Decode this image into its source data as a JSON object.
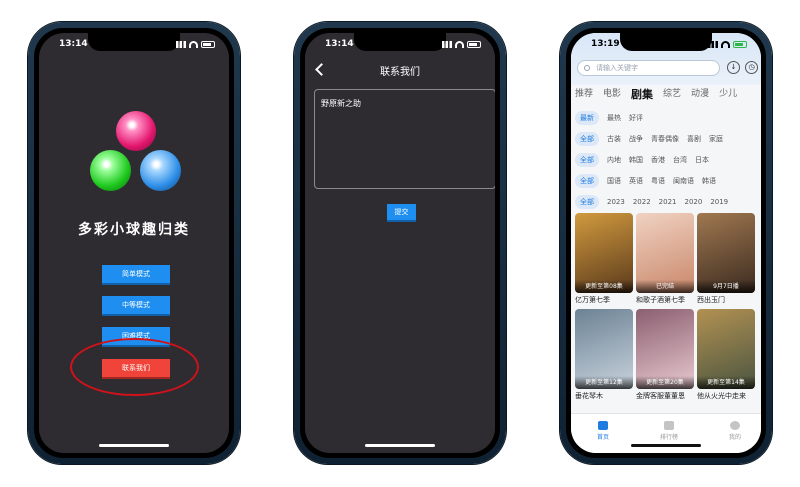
{
  "phone1": {
    "time": "13:14",
    "title": "多彩小球趣归类",
    "buttons": [
      "简单模式",
      "中等模式",
      "困难模式",
      "联系我们"
    ]
  },
  "phone2": {
    "time": "13:14",
    "nav_title": "联系我们",
    "textarea_value": "野原新之助",
    "submit": "提交"
  },
  "phone3": {
    "time": "13:19",
    "search_placeholder": "请输入关键字",
    "category_tabs": [
      "推荐",
      "电影",
      "剧集",
      "综艺",
      "动漫",
      "少儿"
    ],
    "active_category": "剧集",
    "filters": [
      [
        "最新",
        "最热",
        "好评"
      ],
      [
        "全部",
        "古装",
        "战争",
        "青春偶像",
        "喜剧",
        "家庭"
      ],
      [
        "全部",
        "内地",
        "韩国",
        "香港",
        "台湾",
        "日本"
      ],
      [
        "全部",
        "国语",
        "英语",
        "粤语",
        "闽南语",
        "韩语"
      ],
      [
        "全部",
        "2023",
        "2022",
        "2021",
        "2020",
        "2019"
      ]
    ],
    "cards": [
      {
        "name": "亿万第七季",
        "tag": "更新至第08集",
        "color1": "#5a3a1c",
        "color2": "#d19a3e"
      },
      {
        "name": "和歌子酒第七季",
        "tag": "已完结",
        "color1": "#c9876a",
        "color2": "#f0d2c2"
      },
      {
        "name": "西出玉门",
        "tag": "9月7日播",
        "color1": "#3b2b20",
        "color2": "#a07850"
      },
      {
        "name": "垂花琴木",
        "tag": "更新至第12集",
        "color1": "#c8d3dd",
        "color2": "#6c8294"
      },
      {
        "name": "金牌客服董董恩",
        "tag": "更新至第20集",
        "color1": "#e8c9d0",
        "color2": "#8b5f70"
      },
      {
        "name": "他从火光中走来",
        "tag": "更新至第14集",
        "color1": "#4a5540",
        "color2": "#b29152"
      }
    ],
    "tabbar": [
      "首页",
      "排行榜",
      "我的"
    ]
  }
}
